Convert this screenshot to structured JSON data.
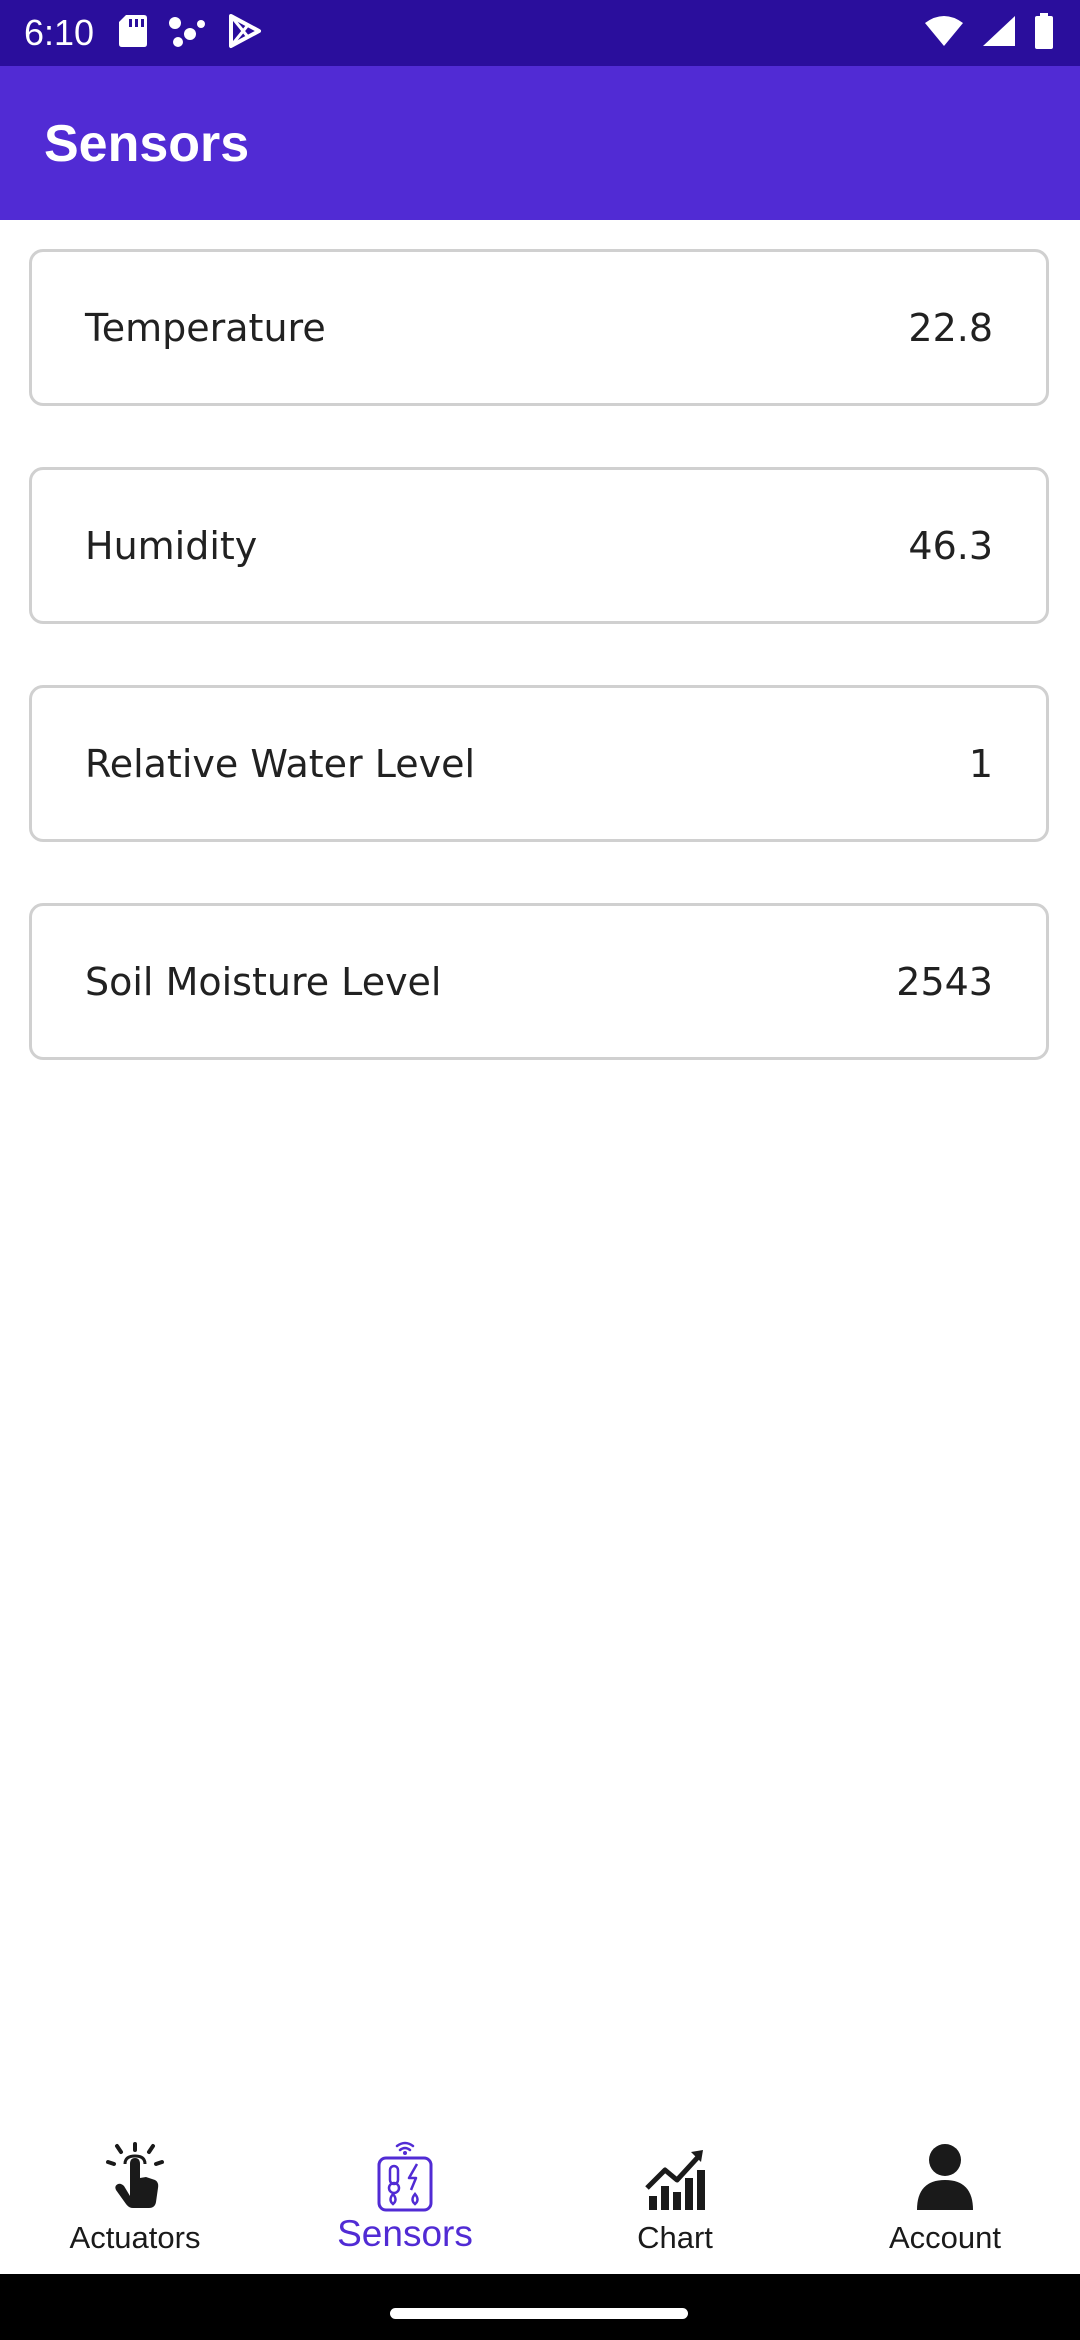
{
  "status_bar": {
    "time": "6:10",
    "left_icons": [
      "sd-card-icon",
      "dots-icon",
      "play-store-icon"
    ],
    "right_icons": [
      "wifi-icon",
      "signal-icon",
      "battery-icon"
    ],
    "background": "#2a0e9c"
  },
  "app_bar": {
    "title": "Sensors",
    "background": "#512bd4"
  },
  "sensors": [
    {
      "label": "Temperature",
      "value": "22.8"
    },
    {
      "label": "Humidity",
      "value": "46.3"
    },
    {
      "label": "Relative Water Level",
      "value": "1"
    },
    {
      "label": "Soil Moisture Level",
      "value": "2543"
    }
  ],
  "bottom_nav": {
    "items": [
      {
        "label": "Actuators",
        "icon": "touch-hand-icon",
        "active": false
      },
      {
        "label": "Sensors",
        "icon": "sensors-icon",
        "active": true
      },
      {
        "label": "Chart",
        "icon": "chart-icon",
        "active": false
      },
      {
        "label": "Account",
        "icon": "person-icon",
        "active": false
      }
    ],
    "active_color": "#512bd4"
  }
}
